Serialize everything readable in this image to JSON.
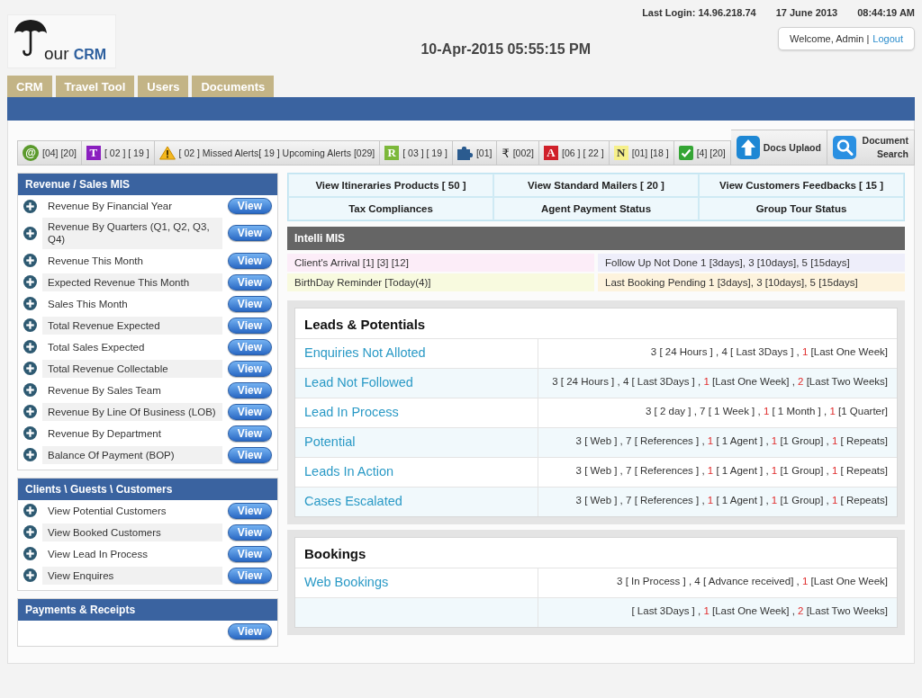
{
  "header": {
    "last_login": "Last Login: 14.96.218.74",
    "date": "17 June 2013",
    "time": "08:44:19 AM",
    "welcome": "Welcome, Admin |",
    "logout": "Logout",
    "datetime": "10-Apr-2015 05:55:15 PM"
  },
  "logo": {
    "text": "our",
    "accent": "CRM"
  },
  "tabs": [
    {
      "label": "CRM"
    },
    {
      "label": "Travel Tool"
    },
    {
      "label": "Users"
    },
    {
      "label": "Documents"
    }
  ],
  "toolbar": [
    {
      "kind": "disc",
      "symbol": "@",
      "color": "#5b9a2c",
      "text": "[04] [20]"
    },
    {
      "kind": "tile",
      "symbol": "T",
      "color": "#8a1fbf",
      "text": "[ 02 ] [ 19 ]"
    },
    {
      "kind": "warning",
      "text": "[ 02 ] Missed Alerts[ 19 ] Upcoming Alerts [029]"
    },
    {
      "kind": "tile",
      "symbol": "R",
      "color": "#7cb83a",
      "text": "[ 03 ] [ 19 ]"
    },
    {
      "kind": "puzzle",
      "text": "[01]"
    },
    {
      "kind": "glyph",
      "symbol": "₹",
      "text": "[002]"
    },
    {
      "kind": "tile",
      "symbol": "A",
      "color": "#d0202a",
      "text": "[06 ] [ 22 ]"
    },
    {
      "kind": "tile",
      "symbol": "N",
      "color": "#f6f08a",
      "text": "[01] [18 ]"
    },
    {
      "kind": "check",
      "text": "[4] [20]"
    },
    {
      "kind": "upload",
      "text": "Docs Uplaod"
    },
    {
      "kind": "search",
      "text": "Document Search"
    }
  ],
  "sidebar": [
    {
      "title": "Revenue / Sales MIS",
      "items": [
        {
          "label": "Revenue By Financial Year",
          "action": "View"
        },
        {
          "label": "Revenue By Quarters (Q1, Q2, Q3, Q4)",
          "action": "View"
        },
        {
          "label": "Revenue This Month",
          "action": "View"
        },
        {
          "label": "Expected Revenue This Month",
          "action": "View"
        },
        {
          "label": "Sales This Month",
          "action": "View"
        },
        {
          "label": "Total Revenue Expected",
          "action": "View"
        },
        {
          "label": "Total Sales Expected",
          "action": "View"
        },
        {
          "label": "Total Revenue Collectable",
          "action": "View"
        },
        {
          "label": "Revenue By Sales Team",
          "action": "View"
        },
        {
          "label": "Revenue By Line Of Business (LOB)",
          "action": "View"
        },
        {
          "label": "Revenue By Department",
          "action": "View"
        },
        {
          "label": "Balance Of Payment (BOP)",
          "action": "View"
        }
      ]
    },
    {
      "title": "Clients \\ Guests \\ Customers",
      "items": [
        {
          "label": "View Potential Customers",
          "action": "View"
        },
        {
          "label": "View Booked Customers",
          "action": "View"
        },
        {
          "label": "View Lead In Process",
          "action": "View"
        },
        {
          "label": "View Enquires",
          "action": "View"
        }
      ]
    },
    {
      "title": "Payments & Receipts",
      "items": [
        {
          "action": "View"
        }
      ]
    }
  ],
  "links": [
    "View Itineraries Products [ 50 ]",
    "View Standard Mailers [ 20 ]",
    "View Customers Feedbacks [ 15 ]",
    "Tax Compliances",
    "Agent Payment Status",
    "Group Tour Status"
  ],
  "intelli_mis": {
    "title": "Intelli MIS",
    "items": [
      {
        "text": "Client's Arrival [1] [3] [12]",
        "color": "#fcedf8"
      },
      {
        "text": "Follow Up Not Done 1 [3days], 3 [10days], 5 [15days]",
        "color": "#eeeefa"
      },
      {
        "text": "BirthDay Reminder [Today(4)]",
        "color": "#f8fadf"
      },
      {
        "text": "Last Booking Pending 1 [3days], 3 [10days], 5 [15days]",
        "color": "#fdf3dd"
      }
    ]
  },
  "leads": {
    "title": "Leads & Potentials",
    "rows": [
      {
        "label": "Enquiries Not Alloted",
        "stats": [
          {
            "count": "3",
            "text": "[ 24 Hours ] ,",
            "alert": false
          },
          {
            "count": "4",
            "text": "[ Last 3Days ] ,",
            "alert": false
          },
          {
            "count": "1",
            "text": "[Last One Week]",
            "alert": true
          }
        ]
      },
      {
        "label": "Lead Not Followed",
        "stats": [
          {
            "count": "3",
            "text": "[ 24 Hours ] ,",
            "alert": false
          },
          {
            "count": "4",
            "text": "[ Last 3Days ] ,",
            "alert": false
          },
          {
            "count": "1",
            "text": "[Last One Week] ,",
            "alert": true
          },
          {
            "count": "2",
            "text": "[Last Two Weeks]",
            "alert": true
          }
        ]
      },
      {
        "label": "Lead In Process",
        "stats": [
          {
            "count": "3",
            "text": "[ 2 day ] ,",
            "alert": false
          },
          {
            "count": "7",
            "text": "[ 1 Week ] ,",
            "alert": false
          },
          {
            "count": "1",
            "text": "[ 1 Month ] ,",
            "alert": true
          },
          {
            "count": "1",
            "text": "[1 Quarter]",
            "alert": true
          }
        ]
      },
      {
        "label": "Potential",
        "stats": [
          {
            "count": "3",
            "text": "[ Web ] ,",
            "alert": false
          },
          {
            "count": "7",
            "text": "[ References ] ,",
            "alert": false
          },
          {
            "count": "1",
            "text": "[ 1 Agent ] ,",
            "alert": true
          },
          {
            "count": "1",
            "text": "[1 Group] ,",
            "alert": true
          },
          {
            "count": "1",
            "text": "[ Repeats]",
            "alert": true
          }
        ]
      },
      {
        "label": "Leads In Action",
        "stats": [
          {
            "count": "3",
            "text": "[ Web ] ,",
            "alert": false
          },
          {
            "count": "7",
            "text": "[ References ] ,",
            "alert": false
          },
          {
            "count": "1",
            "text": "[ 1 Agent ] ,",
            "alert": true
          },
          {
            "count": "1",
            "text": "[1 Group] ,",
            "alert": true
          },
          {
            "count": "1",
            "text": "[ Repeats]",
            "alert": true
          }
        ]
      },
      {
        "label": "Cases Escalated",
        "stats": [
          {
            "count": "3",
            "text": "[ Web ] ,",
            "alert": false
          },
          {
            "count": "7",
            "text": "[ References ] ,",
            "alert": false
          },
          {
            "count": "1",
            "text": "[ 1 Agent ] ,",
            "alert": true
          },
          {
            "count": "1",
            "text": "[1 Group] ,",
            "alert": true
          },
          {
            "count": "1",
            "text": "[ Repeats]",
            "alert": true
          }
        ]
      }
    ]
  },
  "bookings": {
    "title": "Bookings",
    "rows": [
      {
        "label": "Web Bookings",
        "stats": [
          {
            "count": "3",
            "text": "[ In Process ] ,",
            "alert": false
          },
          {
            "count": "4",
            "text": "[ Advance received] ,",
            "alert": false
          },
          {
            "count": "1",
            "text": "[Last One Week]",
            "alert": true
          }
        ]
      },
      {
        "stats": [
          {
            "text": "[ Last 3Days ] ,"
          },
          {
            "count": "1",
            "text": "[Last One Week] ,",
            "alert": true
          },
          {
            "count": "2",
            "text": "[Last Two Weeks]",
            "alert": true
          }
        ]
      }
    ]
  }
}
